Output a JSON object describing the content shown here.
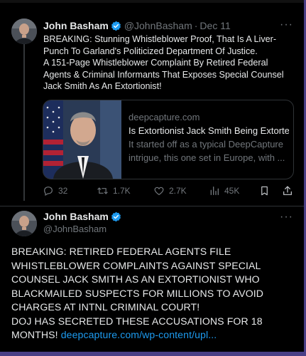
{
  "tweet1": {
    "author_name": "John Basham",
    "handle": "@JohnBasham",
    "date": "Dec 11",
    "text_lines": [
      "BREAKING: Stunning Whistleblower Proof, That Is A Liver-",
      "Punch To Garland's Politicized Department Of Justice.",
      "A 151-Page Whistleblower Complaint By Retired Federal",
      "Agents & Criminal Informants That Exposes Special Counsel",
      "Jack Smith As An Extortionist!"
    ],
    "card": {
      "domain": "deepcapture.com",
      "title": "Is Extortionist Jack Smith Being Extorted?",
      "description": "It started off as a typical DeepCapture intrigue, this one set in Europe, with ..."
    },
    "actions": {
      "replies": "32",
      "reposts": "1.7K",
      "likes": "2.7K",
      "views": "45K"
    }
  },
  "tweet2": {
    "author_name": "John Basham",
    "handle": "@JohnBasham",
    "text_lines": [
      "BREAKING: RETIRED FEDERAL AGENTS FILE",
      "WHISTLEBLOWER COMPLAINTS AGAINST SPECIAL",
      "COUNSEL JACK SMITH AS AN EXTORTIONIST WHO",
      "BLACKMAILED SUSPECTS FOR MILLIONS TO AVOID",
      "CHARGES AT INTNL CRIMINAL COURT!",
      "DOJ HAS SECRETED THESE ACCUSATIONS FOR 18"
    ],
    "last_line_text": "MONTHS!",
    "link_text": "deepcapture.com/wp-content/upl..."
  },
  "colors": {
    "background": "#000000",
    "text": "#e7e9ea",
    "muted": "#71767b",
    "link": "#1d9bf0",
    "verified": "#1d9bf0",
    "frame_accent": "#4a3f86"
  },
  "icons": [
    "verified-badge-icon",
    "more-icon",
    "reply-icon",
    "repost-icon",
    "like-icon",
    "views-icon",
    "bookmark-icon",
    "share-icon"
  ]
}
